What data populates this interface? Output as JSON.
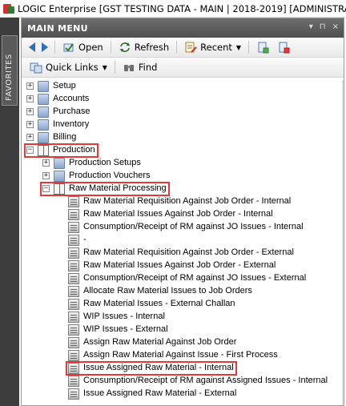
{
  "window": {
    "title": "LOGIC Enterprise [GST TESTING DATA - MAIN | 2018-2019] [ADMINISTRATOR]"
  },
  "favorites": {
    "label": "FAVORITES"
  },
  "panel": {
    "title": "MAIN MENU",
    "header_buttons": [
      "▾",
      "⊓",
      "×"
    ]
  },
  "toolbar": {
    "open_label": "Open",
    "refresh_label": "Refresh",
    "recent_label": "Recent",
    "quick_links_label": "Quick Links",
    "find_label": "Find"
  },
  "tree": {
    "selected_index": 27,
    "items": [
      {
        "label": "Setup",
        "level": 0,
        "expander": "+",
        "icon": "module-icon"
      },
      {
        "label": "Accounts",
        "level": 0,
        "expander": "+",
        "icon": "module-icon"
      },
      {
        "label": "Purchase",
        "level": 0,
        "expander": "+",
        "icon": "module-icon"
      },
      {
        "label": "Inventory",
        "level": 0,
        "expander": "+",
        "icon": "module-icon"
      },
      {
        "label": "Billing",
        "level": 0,
        "expander": "+",
        "icon": "module-icon"
      },
      {
        "label": "Production",
        "level": 0,
        "expander": "−",
        "icon": "open-book-icon"
      },
      {
        "label": "Production Setups",
        "level": 1,
        "expander": "+",
        "icon": "module-icon"
      },
      {
        "label": "Production Vouchers",
        "level": 1,
        "expander": "+",
        "icon": "module-icon"
      },
      {
        "label": "Raw Material Processing",
        "level": 1,
        "expander": "−",
        "icon": "open-book-icon"
      },
      {
        "label": "Raw Material Requisition Against Job Order - Internal",
        "level": 2,
        "expander": "",
        "icon": "document-icon"
      },
      {
        "label": "Raw Material Issues Against Job Order - Internal",
        "level": 2,
        "expander": "",
        "icon": "document-icon"
      },
      {
        "label": "Consumption/Receipt of RM against JO Issues - Internal",
        "level": 2,
        "expander": "",
        "icon": "document-icon"
      },
      {
        "label": "-",
        "level": 2,
        "expander": "",
        "icon": "document-icon"
      },
      {
        "label": "Raw Material Requisition Against Job Order - External",
        "level": 2,
        "expander": "",
        "icon": "document-icon"
      },
      {
        "label": "Raw Material Issues Against Job Order - External",
        "level": 2,
        "expander": "",
        "icon": "document-icon"
      },
      {
        "label": "Consumption/Receipt of RM against JO Issues - External",
        "level": 2,
        "expander": "",
        "icon": "document-icon"
      },
      {
        "label": "Allocate Raw Material Issues to Job Orders",
        "level": 2,
        "expander": "",
        "icon": "document-icon"
      },
      {
        "label": "Raw Material Issues - External Challan",
        "level": 2,
        "expander": "",
        "icon": "document-icon"
      },
      {
        "label": "WIP Issues - Internal",
        "level": 2,
        "expander": "",
        "icon": "document-icon"
      },
      {
        "label": "WIP Issues - External",
        "level": 2,
        "expander": "",
        "icon": "document-icon"
      },
      {
        "label": "Assign Raw Material Against Job Order",
        "level": 2,
        "expander": "",
        "icon": "document-icon"
      },
      {
        "label": "Assign Raw Material Against Issue - First Process",
        "level": 2,
        "expander": "",
        "icon": "document-icon"
      },
      {
        "label": "Issue Assigned Raw Material - Internal",
        "level": 2,
        "expander": "",
        "icon": "document-icon"
      },
      {
        "label": "Consumption/Receipt of RM against Assigned Issues - Internal",
        "level": 2,
        "expander": "",
        "icon": "document-icon"
      },
      {
        "label": "Issue Assigned Raw Material - External",
        "level": 2,
        "expander": "",
        "icon": "document-icon"
      }
    ]
  },
  "highlights": [
    "Production",
    "Raw Material Processing",
    "Issue Assigned Raw Material - Internal"
  ],
  "colors": {
    "selection": "#3399ff",
    "highlight_box": "#e53935",
    "header": "#5a5a5a"
  }
}
